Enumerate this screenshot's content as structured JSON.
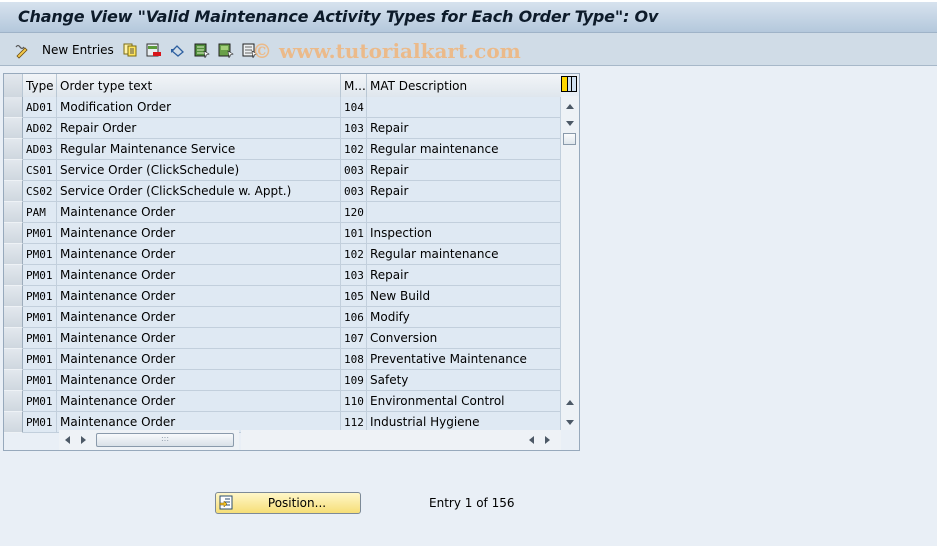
{
  "window": {
    "title": "Change View \"Valid Maintenance Activity Types for Each Order Type\": Ov"
  },
  "toolbar": {
    "items": [
      {
        "icon": "display-change-icon",
        "label": ""
      },
      {
        "icon": "new-entries-icon",
        "label": "New Entries"
      },
      {
        "icon": "copy-as-icon",
        "label": ""
      },
      {
        "icon": "delete-icon",
        "label": ""
      },
      {
        "icon": "undo-change-icon",
        "label": ""
      },
      {
        "icon": "select-all-icon",
        "label": ""
      },
      {
        "icon": "select-block-icon",
        "label": ""
      },
      {
        "icon": "deselect-all-icon",
        "label": ""
      }
    ],
    "new_entries_label": "New Entries"
  },
  "watermark": "© www.tutorialkart.com",
  "table": {
    "columns": [
      {
        "key": "type",
        "label": "Type"
      },
      {
        "key": "text",
        "label": "Order type text"
      },
      {
        "key": "mat",
        "label": "M..."
      },
      {
        "key": "desc",
        "label": "MAT Description"
      }
    ],
    "rows": [
      {
        "type": "AD01",
        "text": "Modification Order",
        "mat": "104",
        "desc": ""
      },
      {
        "type": "AD02",
        "text": "Repair Order",
        "mat": "103",
        "desc": "Repair"
      },
      {
        "type": "AD03",
        "text": "Regular Maintenance Service",
        "mat": "102",
        "desc": "Regular maintenance"
      },
      {
        "type": "CS01",
        "text": "Service Order (ClickSchedule)",
        "mat": "003",
        "desc": "Repair"
      },
      {
        "type": "CS02",
        "text": "Service Order (ClickSchedule w. Appt.)",
        "mat": "003",
        "desc": "Repair"
      },
      {
        "type": "PAM",
        "text": "Maintenance Order",
        "mat": "120",
        "desc": ""
      },
      {
        "type": "PM01",
        "text": "Maintenance Order",
        "mat": "101",
        "desc": "Inspection"
      },
      {
        "type": "PM01",
        "text": "Maintenance Order",
        "mat": "102",
        "desc": "Regular maintenance"
      },
      {
        "type": "PM01",
        "text": "Maintenance Order",
        "mat": "103",
        "desc": "Repair"
      },
      {
        "type": "PM01",
        "text": "Maintenance Order",
        "mat": "105",
        "desc": "New Build"
      },
      {
        "type": "PM01",
        "text": "Maintenance Order",
        "mat": "106",
        "desc": "Modify"
      },
      {
        "type": "PM01",
        "text": "Maintenance Order",
        "mat": "107",
        "desc": "Conversion"
      },
      {
        "type": "PM01",
        "text": "Maintenance Order",
        "mat": "108",
        "desc": "Preventative Maintenance"
      },
      {
        "type": "PM01",
        "text": "Maintenance Order",
        "mat": "109",
        "desc": "Safety"
      },
      {
        "type": "PM01",
        "text": "Maintenance Order",
        "mat": "110",
        "desc": "Environmental Control"
      },
      {
        "type": "PM01",
        "text": "Maintenance Order",
        "mat": "112",
        "desc": "Industrial Hygiene"
      }
    ],
    "scroll_thumb_grip": ":::"
  },
  "footer": {
    "position_button_label": "Position...",
    "entry_info": "Entry 1 of 156"
  },
  "colors": {
    "title_bar": "#b4c8dc",
    "toolbar": "#d0dce7",
    "cell_bg": "#dfe9f3",
    "position_button": "#f6de77",
    "watermark": "#f0b57a"
  }
}
